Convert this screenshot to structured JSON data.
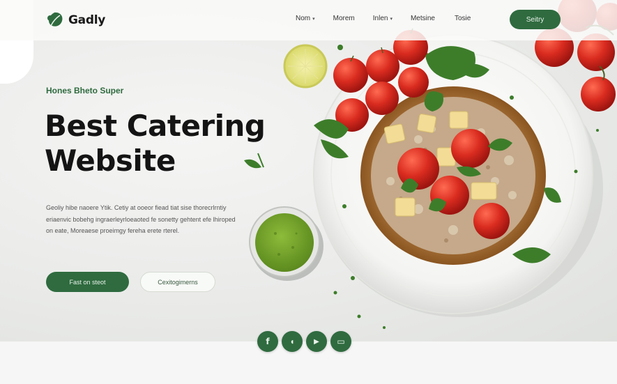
{
  "brand": {
    "name": "Gadly"
  },
  "nav": {
    "links": [
      {
        "label": "Nom",
        "dropdown": true
      },
      {
        "label": "Morem",
        "dropdown": false
      },
      {
        "label": "Inlen",
        "dropdown": true
      },
      {
        "label": "Metsine",
        "dropdown": false
      },
      {
        "label": "Tosie",
        "dropdown": false
      }
    ],
    "cta_label": "Seitry"
  },
  "hero": {
    "eyebrow": "Hones Bheto Super",
    "headline_line1": "Best Catering",
    "headline_line2": "Website",
    "body": "Geoliy hibe naoere Ytik. Cetiy at ooeor fiead tiat sise thorecrlrntiy eriaenvic bobehg ingraerleyrloeaoted fe sonetty gehtent efe lhiroped on eate, Moreaese proeimgy fereha erete rterel.",
    "primary_button": "Fast on steot",
    "secondary_button": "Cexitogimerns"
  },
  "socials": [
    {
      "icon": "facebook-icon",
      "glyph": "f"
    },
    {
      "icon": "chat-icon",
      "glyph": "◖"
    },
    {
      "icon": "play-icon",
      "glyph": "▶"
    },
    {
      "icon": "video-icon",
      "glyph": "▭"
    }
  ],
  "colors": {
    "accent": "#2f6b3f",
    "tomato": "#d92b1f",
    "sauce": "#6f9a2a"
  }
}
